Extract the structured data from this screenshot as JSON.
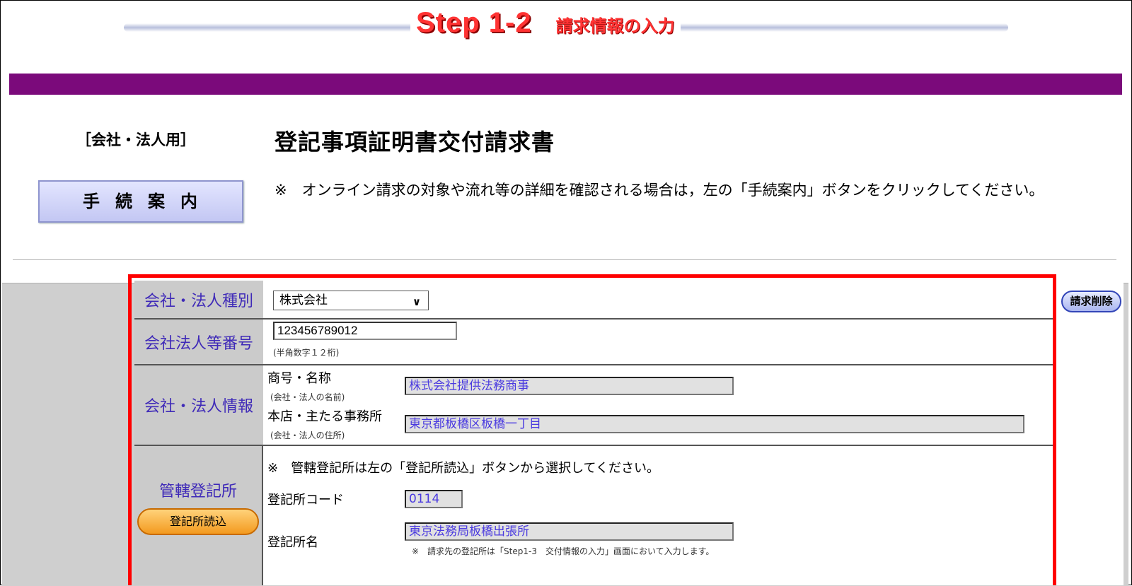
{
  "header": {
    "step": "Step 1-2",
    "step_subtitle": "請求情報の入力"
  },
  "intro": {
    "corp_label": "［会社・法人用］",
    "form_title": "登記事項証明書交付請求書",
    "guide_button": "手続案内",
    "note": "※　オンライン請求の対象や流れ等の詳細を確認される場合は，左の「手続案内」ボタンをクリックしてください。"
  },
  "actions": {
    "delete_request": "請求削除"
  },
  "form": {
    "corp_type": {
      "label": "会社・法人種別",
      "selected": "株式会社"
    },
    "corp_number": {
      "label": "会社法人等番号",
      "value": "123456789012",
      "hint": "(半角数字１２桁)"
    },
    "corp_info": {
      "label": "会社・法人情報",
      "name_label": "商号・名称",
      "name_hint": "(会社・法人の名前)",
      "name_value": "株式会社提供法務商事",
      "address_label": "本店・主たる事務所",
      "address_hint": "(会社・法人の住所)",
      "address_value": "東京都板橋区板橋一丁目"
    },
    "registry": {
      "label": "管轄登記所",
      "load_button": "登記所読込",
      "note": "※　管轄登記所は左の「登記所読込」ボタンから選択してください。",
      "code_label": "登記所コード",
      "code_value": "0114",
      "name_label": "登記所名",
      "name_value": "東京法務局板橋出張所",
      "name_note": "※　請求先の登記所は「Step1-3　交付情報の入力」画面において入力します。"
    }
  }
}
